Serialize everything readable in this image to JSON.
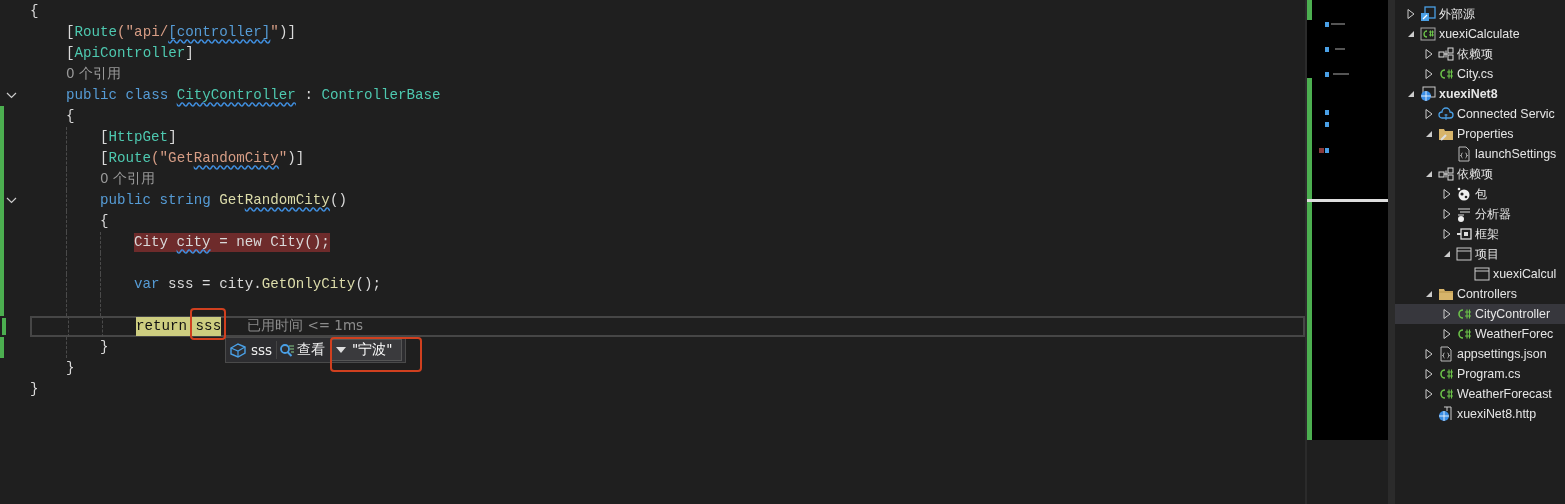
{
  "editor": {
    "lines": [
      {
        "segments": [
          {
            "text": "{",
            "kind": "plain"
          }
        ],
        "children": [
          {
            "segments": [
              {
                "text": "[",
                "kind": "plain"
              },
              {
                "text": "Route",
                "kind": "type"
              },
              {
                "text": "(\"api/",
                "kind": "str"
              },
              {
                "text": "[controller]",
                "kind": "kw",
                "squiggle": true
              },
              {
                "text": "\"",
                "kind": "str"
              },
              {
                "text": ")]",
                "kind": "plain"
              }
            ]
          },
          {
            "segments": [
              {
                "text": "[",
                "kind": "plain"
              },
              {
                "text": "ApiController",
                "kind": "type"
              },
              {
                "text": "]",
                "kind": "plain"
              }
            ]
          },
          {
            "lens": "0 个引用"
          },
          {
            "fold": true,
            "segments": [
              {
                "text": "public class ",
                "kind": "kw"
              },
              {
                "text": "CityController",
                "kind": "type",
                "squiggle": true
              },
              {
                "text": " : ",
                "kind": "plain"
              },
              {
                "text": "ControllerBase",
                "kind": "type"
              }
            ]
          },
          {
            "changed": true,
            "segments": [
              {
                "text": "{",
                "kind": "plain"
              }
            ],
            "children": [
              {
                "changed": true,
                "segments": [
                  {
                    "text": "[",
                    "kind": "plain"
                  },
                  {
                    "text": "HttpGet",
                    "kind": "type"
                  },
                  {
                    "text": "]",
                    "kind": "plain"
                  }
                ]
              },
              {
                "changed": true,
                "segments": [
                  {
                    "text": "[",
                    "kind": "plain"
                  },
                  {
                    "text": "Route",
                    "kind": "type"
                  },
                  {
                    "text": "(\"Get",
                    "kind": "str"
                  },
                  {
                    "text": "RandomCity",
                    "kind": "str",
                    "squiggle": true
                  },
                  {
                    "text": "\"",
                    "kind": "str"
                  },
                  {
                    "text": ")]",
                    "kind": "plain"
                  }
                ]
              },
              {
                "changed": true,
                "lens": "0 个引用"
              },
              {
                "fold": true,
                "changed": true,
                "segments": [
                  {
                    "text": "public string ",
                    "kind": "kw"
                  },
                  {
                    "text": "Get",
                    "kind": "method"
                  },
                  {
                    "text": "RandomCity",
                    "kind": "method",
                    "squiggle": true
                  },
                  {
                    "text": "()",
                    "kind": "plain"
                  }
                ]
              },
              {
                "changed": true,
                "segments": [
                  {
                    "text": "{",
                    "kind": "plain"
                  }
                ],
                "children": [
                  {
                    "changed": true,
                    "breakpoint": true,
                    "segments": [
                      {
                        "text": "City ",
                        "kind": "plain"
                      },
                      {
                        "text": "city",
                        "kind": "plain",
                        "squiggle": true
                      },
                      {
                        "text": " = new City();",
                        "kind": "plain"
                      }
                    ]
                  },
                  {
                    "changed": true
                  },
                  {
                    "changed": true,
                    "segments": [
                      {
                        "text": "var ",
                        "kind": "kw"
                      },
                      {
                        "text": "sss = city.",
                        "kind": "plain"
                      },
                      {
                        "text": "GetOnlyCity",
                        "kind": "method"
                      },
                      {
                        "text": "();",
                        "kind": "plain"
                      }
                    ]
                  },
                  {
                    "changed": true
                  },
                  {
                    "changed": true,
                    "current": true,
                    "segments": [
                      {
                        "text": "return ",
                        "kind": "kw"
                      },
                      {
                        "text": "sss",
                        "kind": "plain"
                      }
                    ],
                    "tip": "已用时间 <= 1ms",
                    "data_tip": {
                      "name": "sss",
                      "view_label": "查看",
                      "value": "\"宁波\""
                    }
                  }
                ]
              },
              {
                "changed": true,
                "segments": [
                  {
                    "text": "}",
                    "kind": "plain"
                  }
                ]
              }
            ]
          },
          {
            "segments": [
              {
                "text": "}",
                "kind": "plain"
              }
            ]
          }
        ]
      },
      {
        "segments": [
          {
            "text": "}",
            "kind": "plain"
          }
        ]
      }
    ]
  },
  "explorer": {
    "items": [
      {
        "label": "外部源",
        "kind": "external",
        "expanded": false,
        "selected": false
      },
      {
        "label": "xuexiCalculate",
        "kind": "csproj",
        "expanded": true,
        "selected": false,
        "children": [
          {
            "label": "依赖项",
            "kind": "deps",
            "expanded": false,
            "selected": false
          },
          {
            "label": "City.cs",
            "kind": "cs",
            "expanded": false,
            "selected": false
          }
        ]
      },
      {
        "label": "xuexiNet8",
        "kind": "web",
        "expanded": true,
        "selected": false,
        "bold": true,
        "children": [
          {
            "label": "Connected Servic",
            "kind": "cloud",
            "expanded": false,
            "selected": false
          },
          {
            "label": "Properties",
            "kind": "props",
            "expanded": true,
            "selected": false,
            "children": [
              {
                "label": "launchSettings",
                "kind": "json",
                "selected": false
              }
            ]
          },
          {
            "label": "依赖项",
            "kind": "deps",
            "expanded": true,
            "selected": false,
            "children": [
              {
                "label": "包",
                "kind": "package",
                "expanded": false,
                "selected": false
              },
              {
                "label": "分析器",
                "kind": "analyzer",
                "expanded": false,
                "selected": false
              },
              {
                "label": "框架",
                "kind": "framework",
                "expanded": false,
                "selected": false
              },
              {
                "label": "项目",
                "kind": "window",
                "expanded": true,
                "selected": false,
                "children": [
                  {
                    "label": "xuexiCalcul",
                    "kind": "window",
                    "selected": false
                  }
                ]
              }
            ]
          },
          {
            "label": "Controllers",
            "kind": "folder",
            "expanded": true,
            "selected": false,
            "children": [
              {
                "label": "CityController",
                "kind": "cs",
                "expanded": false,
                "selected": true
              },
              {
                "label": "WeatherForec",
                "kind": "cs",
                "expanded": false,
                "selected": false
              }
            ]
          },
          {
            "label": "appsettings.json",
            "kind": "json",
            "expanded": false,
            "selected": false
          },
          {
            "label": "Program.cs",
            "kind": "cs",
            "expanded": false,
            "selected": false
          },
          {
            "label": "WeatherForecast",
            "kind": "cs",
            "expanded": false,
            "selected": false
          },
          {
            "label": "xuexiNet8.http",
            "kind": "http",
            "selected": false
          }
        ]
      }
    ]
  }
}
